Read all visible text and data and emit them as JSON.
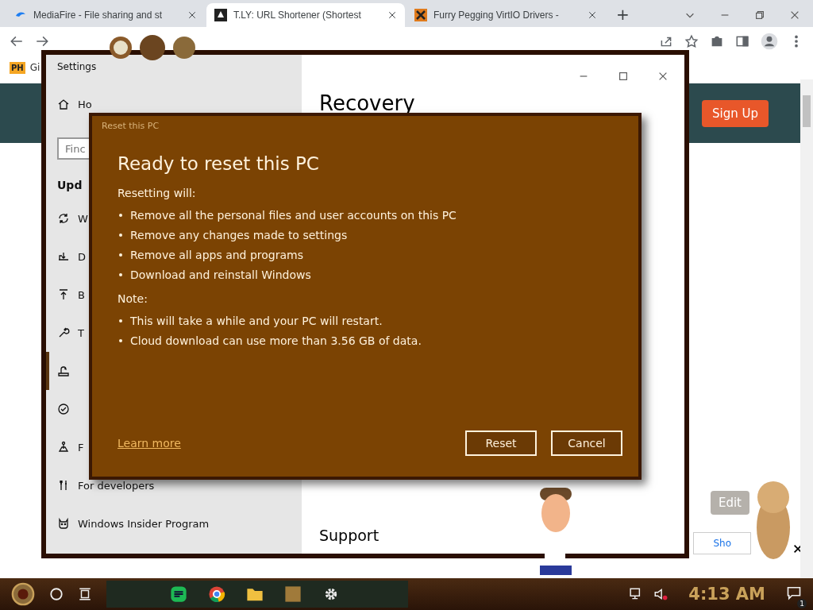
{
  "browser": {
    "tabs": [
      {
        "title": "MediaFire - File sharing and st",
        "selected": false
      },
      {
        "title": "T.LY: URL Shortener (Shortest",
        "selected": true
      },
      {
        "title": "Furry Pegging VirtIO Drivers -",
        "selected": false
      }
    ],
    "new_tab": "+",
    "bookmark": {
      "badge": "PH",
      "label": "Gi"
    }
  },
  "page": {
    "signup": "Sign Up",
    "edit": "Edit",
    "bottom_button": "Sho"
  },
  "settings": {
    "title": "Settings",
    "home": "Ho",
    "search_placeholder": "Finc",
    "section": "Upd",
    "items": [
      {
        "label": "W",
        "selected": false
      },
      {
        "label": "D",
        "selected": false
      },
      {
        "label": "B",
        "selected": false
      },
      {
        "label": "T",
        "selected": false
      },
      {
        "selected": true
      },
      {
        "selected": false
      },
      {
        "label": "F",
        "selected": false
      },
      {
        "label": "For developers",
        "selected": false
      },
      {
        "label": "Windows Insider Program",
        "selected": false
      }
    ],
    "heading": "Recovery",
    "support": "Support"
  },
  "dialog": {
    "title": "Reset this PC",
    "heading": "Ready to reset this PC",
    "intro": "Resetting will:",
    "actions": [
      "Remove all the personal files and user accounts on this PC",
      "Remove any changes made to settings",
      "Remove all apps and programs",
      "Download and reinstall Windows"
    ],
    "note_label": "Note:",
    "notes": [
      "This will take a while and your PC will restart.",
      "Cloud download can use more than 3.56 GB of data."
    ],
    "link": "Learn more",
    "buttons": [
      "Reset",
      "Cancel"
    ]
  },
  "taskbar": {
    "clock": "4:13 AM",
    "notifications": "1"
  }
}
